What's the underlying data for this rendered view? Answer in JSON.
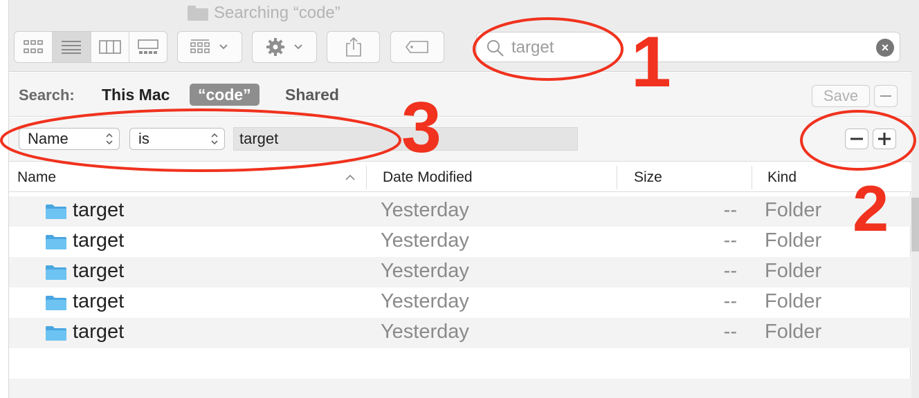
{
  "window": {
    "title": "Searching “code”"
  },
  "toolbar": {
    "view_buttons": [
      "icon-view",
      "list-view",
      "column-view",
      "gallery-view"
    ],
    "active_view": "list-view",
    "search": {
      "value": "target",
      "placeholder": "Search"
    }
  },
  "scope": {
    "label": "Search:",
    "options": [
      "This Mac",
      "“code”",
      "Shared"
    ],
    "selected": "“code”",
    "save_label": "Save"
  },
  "criteria": {
    "attribute": "Name",
    "operator": "is",
    "value": "target"
  },
  "columns": [
    "Name",
    "Date Modified",
    "Size",
    "Kind"
  ],
  "sort": {
    "column": "Name",
    "direction": "ascending"
  },
  "rows": [
    {
      "name": "target",
      "date": "Yesterday",
      "size": "--",
      "kind": "Folder"
    },
    {
      "name": "target",
      "date": "Yesterday",
      "size": "--",
      "kind": "Folder"
    },
    {
      "name": "target",
      "date": "Yesterday",
      "size": "--",
      "kind": "Folder"
    },
    {
      "name": "target",
      "date": "Yesterday",
      "size": "--",
      "kind": "Folder"
    },
    {
      "name": "target",
      "date": "Yesterday",
      "size": "--",
      "kind": "Folder"
    }
  ],
  "annotations": {
    "color": "#f0321e",
    "numbers": [
      "1",
      "2",
      "3"
    ]
  },
  "colors": {
    "folder": "#5ab8ec",
    "selected_scope": "#8e8e8e"
  }
}
